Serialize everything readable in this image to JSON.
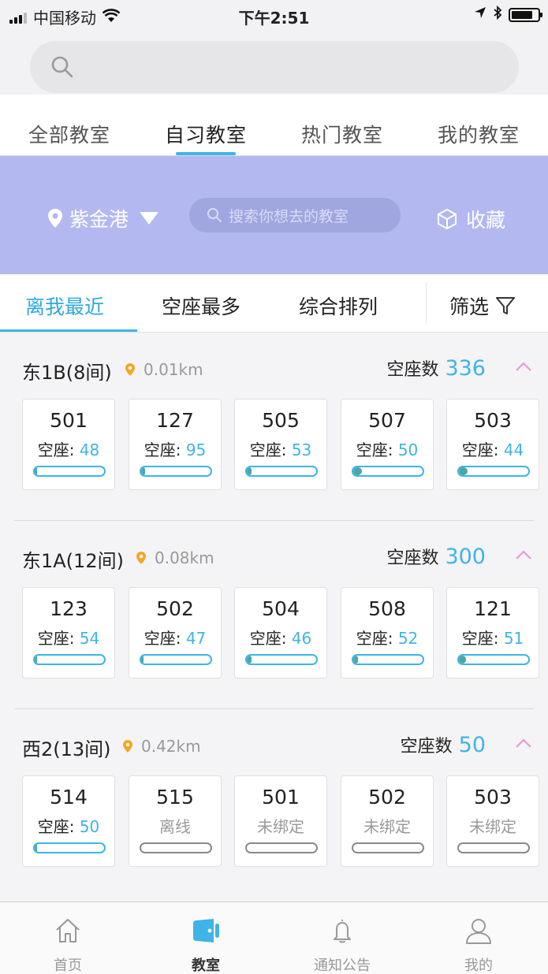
{
  "status_bar": {
    "carrier": "中国移动",
    "time": "下午2:51"
  },
  "tabs": [
    {
      "label": "全部教室"
    },
    {
      "label": "自习教室"
    },
    {
      "label": "热门教室"
    },
    {
      "label": "我的教室"
    }
  ],
  "active_tab": "自习教室",
  "banner": {
    "location": "紫金港",
    "search_placeholder": "搜索你想去的教室",
    "collect_label": "收藏"
  },
  "sort": {
    "options": [
      "离我最近",
      "空座最多",
      "综合排列"
    ],
    "active": "离我最近",
    "filter_label": "筛选"
  },
  "empty_label": "空座数",
  "seat_label": "空座:",
  "colors": {
    "accent": "#3fb4e6",
    "banner": "#b3b8f0",
    "location_pin": "#f6a623",
    "chevron": "#e79ad6"
  },
  "buildings": [
    {
      "name": "东1B(8间)",
      "distance": "0.01km",
      "empty_count": "336",
      "rooms": [
        {
          "number": "501",
          "seats": "48",
          "fill": 0.03
        },
        {
          "number": "127",
          "seats": "95",
          "fill": 0.06
        },
        {
          "number": "505",
          "seats": "53",
          "fill": 0.07
        },
        {
          "number": "507",
          "seats": "50",
          "fill": 0.12
        },
        {
          "number": "503",
          "seats": "44",
          "fill": 0.12
        }
      ]
    },
    {
      "name": "东1A(12间)",
      "distance": "0.08km",
      "empty_count": "300",
      "rooms": [
        {
          "number": "123",
          "seats": "54",
          "fill": 0.03
        },
        {
          "number": "502",
          "seats": "47",
          "fill": 0.03
        },
        {
          "number": "504",
          "seats": "46",
          "fill": 0.07
        },
        {
          "number": "508",
          "seats": "52",
          "fill": 0.07
        },
        {
          "number": "121",
          "seats": "51",
          "fill": 0.1
        }
      ]
    },
    {
      "name": "西2(13间)",
      "distance": "0.42km",
      "empty_count": "50",
      "rooms": [
        {
          "number": "514",
          "seats": "50",
          "fill": 0.03
        },
        {
          "number": "515",
          "status": "离线"
        },
        {
          "number": "501",
          "status": "未绑定"
        },
        {
          "number": "502",
          "status": "未绑定"
        },
        {
          "number": "503",
          "status": "未绑定"
        }
      ]
    }
  ],
  "bottom_nav": [
    {
      "label": "首页",
      "icon": "home-icon"
    },
    {
      "label": "教室",
      "icon": "classroom-icon"
    },
    {
      "label": "通知公告",
      "icon": "bell-icon"
    },
    {
      "label": "我的",
      "icon": "user-icon"
    }
  ],
  "active_nav": "教室"
}
